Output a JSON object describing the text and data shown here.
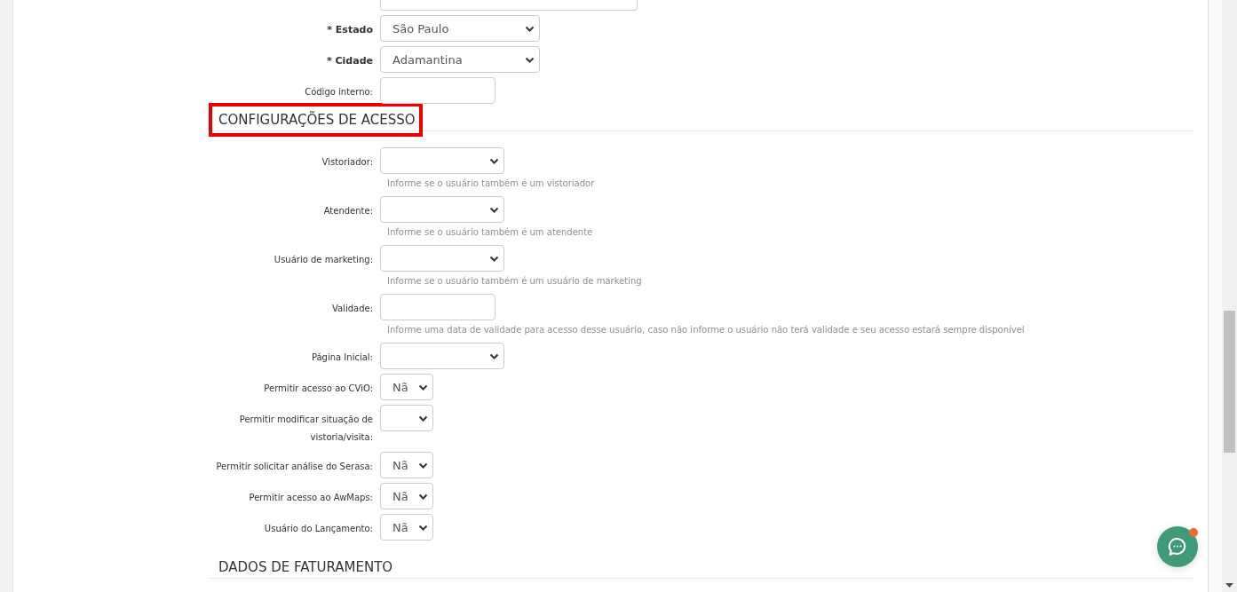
{
  "address_fields": [
    {
      "kind": "wide-select",
      "label": "* Estado",
      "required": true,
      "value": "São Paulo"
    },
    {
      "kind": "wide-select",
      "label": "* Cidade",
      "required": true,
      "value": "Adamantina"
    },
    {
      "kind": "input",
      "label": "Código interno:",
      "required": false
    }
  ],
  "sections": [
    {
      "title": "CONFIGURAÇÕES DE ACESSO",
      "highlighted": true,
      "fields": [
        {
          "kind": "select",
          "label": "Vistoriador:",
          "required": false,
          "help": "Informe se o usuário também é um vistoriador"
        },
        {
          "kind": "select",
          "label": "Atendente:",
          "required": false,
          "help": "Informe se o usuário também é um atendente"
        },
        {
          "kind": "select",
          "label": "Usuário de marketing:",
          "required": false,
          "help": "Informe se o usuário também é um usuário de marketing"
        },
        {
          "kind": "input",
          "label": "Validade:",
          "required": false,
          "help": "Informe uma data de validade para acesso desse usuário, caso não informe o usuário não terá validade e seu acesso estará sempre disponível"
        },
        {
          "kind": "select",
          "label": "Página Inicial:",
          "required": false
        },
        {
          "kind": "short-select",
          "label": "Permitir acesso ao CViO:",
          "required": false,
          "value": "Nã"
        },
        {
          "kind": "short-select",
          "label": "Permitir modificar situação de vistoria/visita:",
          "required": false
        },
        {
          "kind": "short-select",
          "label": "Permitir solicitar análise do Serasa:",
          "required": false,
          "value": "Nã"
        },
        {
          "kind": "short-select",
          "label": "Permitir acesso ao AwMaps:",
          "required": false,
          "value": "Nã"
        },
        {
          "kind": "short-select",
          "label": "Usuário do Lançamento:",
          "required": false,
          "value": "Nã"
        }
      ]
    },
    {
      "title": "DADOS DE FATURAMENTO",
      "highlighted": false
    }
  ]
}
